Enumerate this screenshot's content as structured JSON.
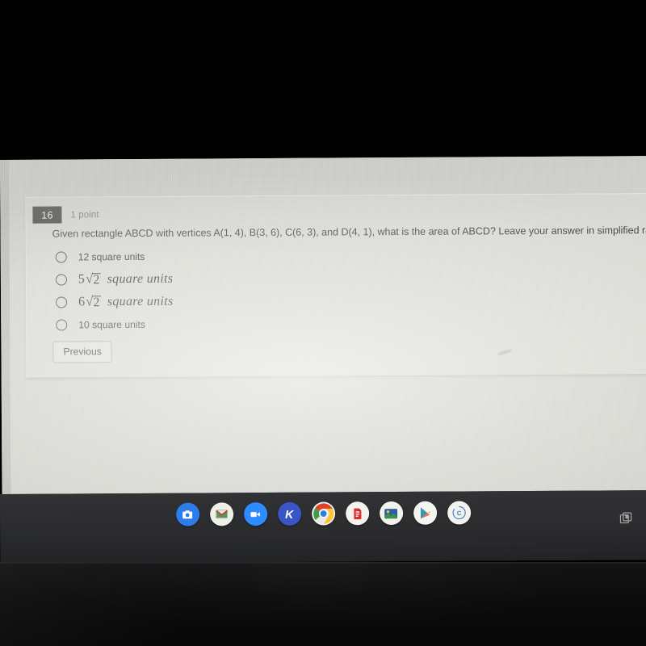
{
  "quiz": {
    "question_number": "16",
    "points_label": "1 point",
    "question_text": "Given rectangle ABCD with vertices A(1, 4), B(3, 6), C(6, 3), and D(4, 1), what is the area of ABCD? Leave your answer in simplified radical form.",
    "options": [
      {
        "style": "plain",
        "label": "12 square units"
      },
      {
        "style": "math",
        "coefficient": "5",
        "radicand": "2",
        "units": "square units",
        "label": "5√2 square units"
      },
      {
        "style": "math",
        "coefficient": "6",
        "radicand": "2",
        "units": "square units",
        "label": "6√2 square units"
      },
      {
        "style": "plain",
        "label": "10 square units"
      }
    ],
    "selected_option": null,
    "previous_button": "Previous"
  },
  "shelf": {
    "apps": [
      {
        "name": "camera-app-icon",
        "label": "Camera",
        "color": "#2b7de9"
      },
      {
        "name": "gmail-app-icon",
        "label": "Gmail",
        "color": "#f0f0ea"
      },
      {
        "name": "zoom-app-icon",
        "label": "Zoom",
        "color": "#2d8cff"
      },
      {
        "name": "kahoot-app-icon",
        "label": "Kahoot",
        "color": "#3a56c4"
      },
      {
        "name": "chrome-app-icon",
        "label": "Chrome",
        "color": "#f1f1ef",
        "running": true
      },
      {
        "name": "pear-deck-app-icon",
        "label": "Pear Deck",
        "color": "#f3f3ef"
      },
      {
        "name": "photos-app-icon",
        "label": "Photos",
        "color": "#f2f2ee"
      },
      {
        "name": "play-store-app-icon",
        "label": "Play Store",
        "color": "#f4f4f0"
      },
      {
        "name": "clever-app-icon",
        "label": "Clever",
        "color": "#f2f2ef"
      }
    ],
    "tray": {
      "name": "window-overview-icon",
      "label": "Show windows"
    }
  },
  "colors": {
    "screen_background": "#cfd0ca",
    "card_background": "#d6d7d1",
    "question_badge": "#3b3c3b",
    "shelf_background": "#2f3033",
    "bezel": "#010101",
    "text": "#3a3b39"
  }
}
